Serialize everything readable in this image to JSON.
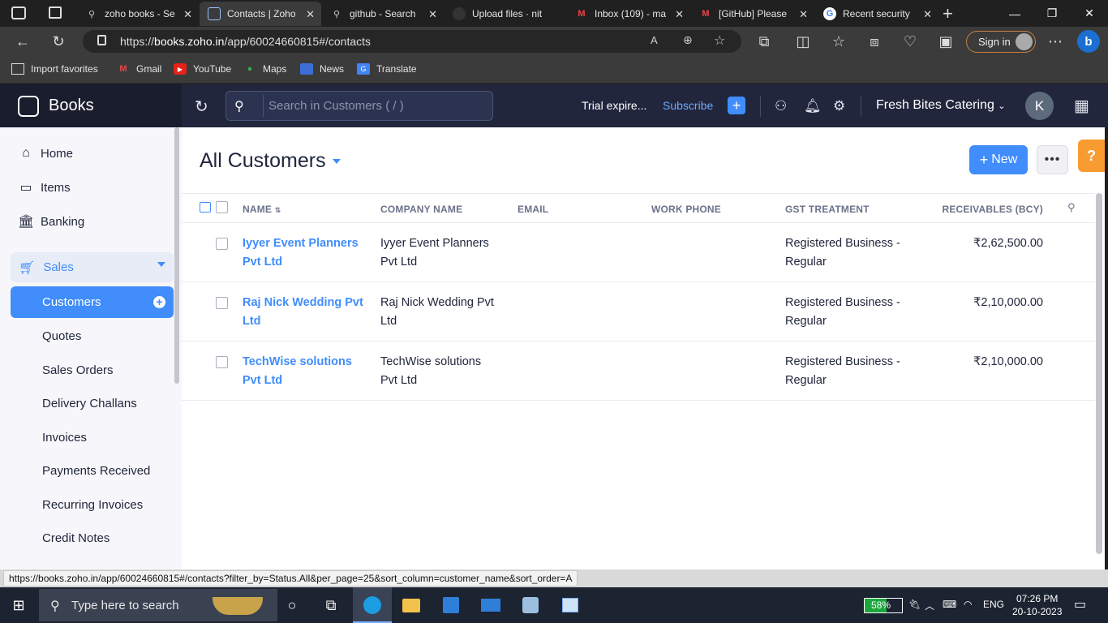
{
  "browser": {
    "tabs": [
      {
        "title": "zoho books - Se",
        "icon": "search-icon"
      },
      {
        "title": "Contacts | Zoho",
        "icon": "zoho-books-icon"
      },
      {
        "title": "github - Search",
        "icon": "search-icon"
      },
      {
        "title": "Upload files · nit",
        "icon": "github-icon"
      },
      {
        "title": "Inbox (109) - ma",
        "icon": "gmail-icon"
      },
      {
        "title": "[GitHub] Please",
        "icon": "gmail-icon"
      },
      {
        "title": "Recent security",
        "icon": "google-icon"
      }
    ],
    "url_prefix": "https://",
    "url_host": "books.zoho.in",
    "url_path": "/app/60024660815#/contacts",
    "sign_in": "Sign in",
    "favorites": [
      {
        "label": "Import favorites",
        "icon": "import-icon"
      },
      {
        "label": "Gmail",
        "icon": "gmail-icon"
      },
      {
        "label": "YouTube",
        "icon": "youtube-icon"
      },
      {
        "label": "Maps",
        "icon": "maps-icon"
      },
      {
        "label": "News",
        "icon": "news-icon"
      },
      {
        "label": "Translate",
        "icon": "translate-icon"
      }
    ]
  },
  "app": {
    "brand": "Books",
    "search_placeholder": "Search in Customers ( / )",
    "trial": "Trial expire...",
    "subscribe": "Subscribe",
    "org_name": "Fresh Bites Catering",
    "avatar_letter": "K",
    "accent": "#408dfb"
  },
  "sidebar": {
    "top_items": [
      {
        "label": "Home",
        "icon": "home-icon"
      },
      {
        "label": "Items",
        "icon": "items-icon"
      },
      {
        "label": "Banking",
        "icon": "bank-icon"
      }
    ],
    "sales_label": "Sales",
    "customers_label": "Customers",
    "sub_items": [
      "Quotes",
      "Sales Orders",
      "Delivery Challans",
      "Invoices",
      "Payments Received",
      "Recurring Invoices",
      "Credit Notes"
    ]
  },
  "main": {
    "title": "All Customers",
    "new_label": "New",
    "more_label": "•••",
    "help_label": "?",
    "columns": [
      "NAME",
      "COMPANY NAME",
      "EMAIL",
      "WORK PHONE",
      "GST TREATMENT",
      "RECEIVABLES (BCY)"
    ],
    "rows": [
      {
        "name_l1": "Iyyer Event Planners",
        "name_l2": "Pvt Ltd",
        "company_l1": "Iyyer Event Planners",
        "company_l2": "Pvt Ltd",
        "email": "",
        "phone": "",
        "gst_l1": "Registered Business -",
        "gst_l2": "Regular",
        "receivables": "₹2,62,500.00"
      },
      {
        "name_l1": "Raj Nick Wedding Pvt",
        "name_l2": "Ltd",
        "company_l1": "Raj Nick Wedding Pvt",
        "company_l2": "Ltd",
        "email": "",
        "phone": "",
        "gst_l1": "Registered Business -",
        "gst_l2": "Regular",
        "receivables": "₹2,10,000.00"
      },
      {
        "name_l1": "TechWise solutions",
        "name_l2": "Pvt Ltd",
        "company_l1": "TechWise solutions",
        "company_l2": "Pvt Ltd",
        "email": "",
        "phone": "",
        "gst_l1": "Registered Business -",
        "gst_l2": "Regular",
        "receivables": "₹2,10,000.00"
      }
    ]
  },
  "status_url": "https://books.zoho.in/app/60024660815#/contacts?filter_by=Status.All&per_page=25&sort_column=customer_name&sort_order=A",
  "taskbar": {
    "search_placeholder": "Type here to search",
    "battery": "58%",
    "battery_level": 0.58,
    "lang": "ENG",
    "time": "07:26 PM",
    "date": "20-10-2023"
  }
}
